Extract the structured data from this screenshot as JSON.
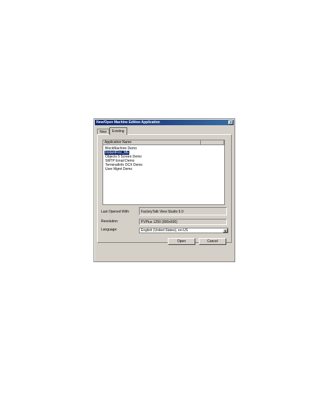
{
  "window": {
    "title": "New/Open Machine Edition Application",
    "close_glyph": "x"
  },
  "tabs": [
    {
      "label": "New"
    },
    {
      "label": "Existing"
    }
  ],
  "app_list": {
    "column_header": "Application Name",
    "items": [
      "BlockMachine Demo",
      "InstantFizz_ME",
      "Objects 5 Screen Demo",
      "SMTP Email Demo",
      "TerminalInfo OCX Demo",
      "User Mgmt Demo"
    ],
    "selected_index": 1
  },
  "fields": {
    "last_opened_label": "Last Opened With:",
    "last_opened_value": "FactoryTalk View Studio 6.0",
    "resolution_label": "Resolution:",
    "resolution_value": "PVPlus 1250 (800x600)",
    "language_label": "Language:",
    "language_value": "English (United States), en-US"
  },
  "buttons": {
    "open": "Open",
    "cancel": "Cancel"
  }
}
